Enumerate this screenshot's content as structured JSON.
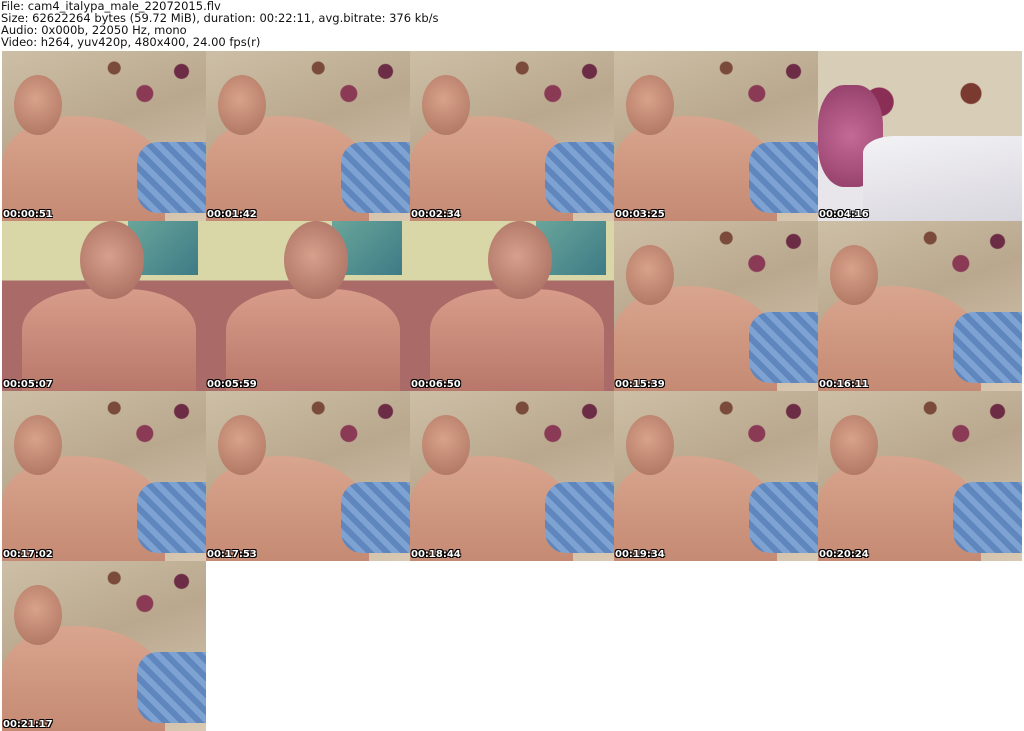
{
  "header": {
    "file_line": "File: cam4_italypa_male_22072015.flv",
    "size_line": "Size: 62622264 bytes (59.72 MiB), duration: 00:22:11, avg.bitrate: 376 kb/s",
    "audio_line": "Audio: 0x000b, 22050 Hz, mono",
    "video_line": "Video: h264, yuv420p, 480x400, 24.00 fps(r)"
  },
  "thumbnails": [
    {
      "timestamp": "00:00:51",
      "scene": "bed"
    },
    {
      "timestamp": "00:01:42",
      "scene": "bed"
    },
    {
      "timestamp": "00:02:34",
      "scene": "bed"
    },
    {
      "timestamp": "00:03:25",
      "scene": "bed"
    },
    {
      "timestamp": "00:04:16",
      "scene": "sheet"
    },
    {
      "timestamp": "00:05:07",
      "scene": "room"
    },
    {
      "timestamp": "00:05:59",
      "scene": "room"
    },
    {
      "timestamp": "00:06:50",
      "scene": "room"
    },
    {
      "timestamp": "00:15:39",
      "scene": "bed"
    },
    {
      "timestamp": "00:16:11",
      "scene": "bed"
    },
    {
      "timestamp": "00:17:02",
      "scene": "bed"
    },
    {
      "timestamp": "00:17:53",
      "scene": "bed"
    },
    {
      "timestamp": "00:18:44",
      "scene": "bed"
    },
    {
      "timestamp": "00:19:34",
      "scene": "bed"
    },
    {
      "timestamp": "00:20:24",
      "scene": "bed"
    },
    {
      "timestamp": "00:21:17",
      "scene": "bed"
    }
  ]
}
